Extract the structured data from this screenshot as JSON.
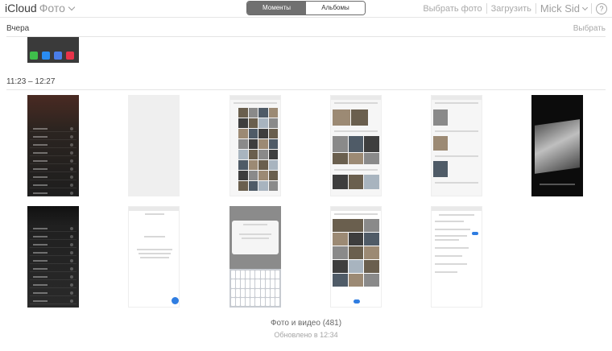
{
  "header": {
    "brand": "iCloud",
    "app_name": "Фото",
    "tabs": [
      {
        "label": "Моменты",
        "active": true
      },
      {
        "label": "Альбомы",
        "active": false
      }
    ],
    "select_photo": "Выбрать фото",
    "upload": "Загрузить",
    "user": "Mick Sid",
    "help": "?"
  },
  "sections": [
    {
      "title": "Вчера",
      "action": "Выбрать"
    },
    {
      "title": "11:23 – 12:27"
    }
  ],
  "footer": {
    "count": "Фото и видео (481)",
    "updated": "Обновлено в 12:34"
  },
  "colors": {
    "segment_active": "#707070",
    "accent_blue": "#2f7de1"
  }
}
